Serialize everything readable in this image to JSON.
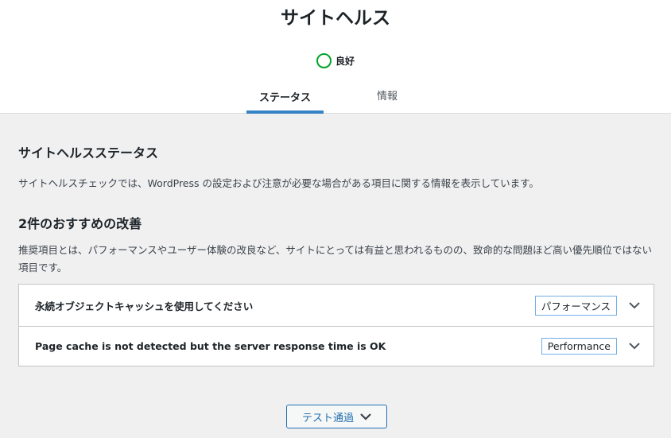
{
  "header": {
    "title": "サイトヘルス",
    "status": {
      "label": "良好",
      "color": "#00a32a",
      "icon": "status-good-circle-icon"
    },
    "tabs": [
      {
        "label": "ステータス",
        "active": true
      },
      {
        "label": "情報",
        "active": false
      }
    ],
    "accent_color": "#3582c4"
  },
  "main": {
    "section_title": "サイトヘルスステータス",
    "section_description": "サイトヘルスチェックでは、WordPress の設定および注意が必要な場合がある項目に関する情報を表示しています。",
    "recommended": {
      "count_title": "2件のおすすめの改善",
      "description": "推奨項目とは、パフォーマンスやユーザー体験の改良など、サイトにとっては有益と思われるものの、致命的な問題ほど高い優先順位ではない項目です。",
      "items": [
        {
          "title": "永続オブジェクトキャッシュを使用してください",
          "badge": "パフォーマンス",
          "icon": "chevron-down-icon"
        },
        {
          "title": "Page cache is not detected but the server response time is OK",
          "badge": "Performance",
          "icon": "chevron-down-icon"
        }
      ]
    },
    "passed_tests_button": {
      "label": "テスト通過",
      "icon": "chevron-down-icon"
    }
  }
}
